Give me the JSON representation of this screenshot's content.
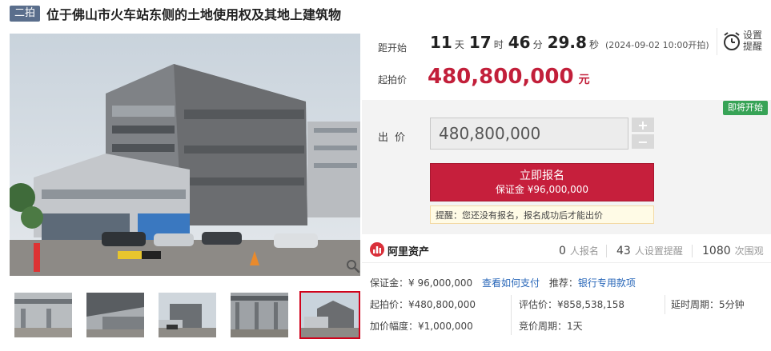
{
  "header": {
    "auction_tag": "二拍",
    "title": "位于佛山市火车站东侧的土地使用权及其地上建筑物"
  },
  "countdown": {
    "label": "距开始",
    "days": "11",
    "days_unit": "天",
    "hours": "17",
    "hours_unit": "时",
    "minutes": "46",
    "minutes_unit": "分",
    "seconds": "29.8",
    "seconds_unit": "秒",
    "start_text": "(2024-09-02 10:00开拍)"
  },
  "remind": {
    "label": "设置提醒",
    "icon": "alarm-clock-icon"
  },
  "start_price": {
    "label": "起拍价",
    "value": "480,800,000",
    "unit": "元"
  },
  "bid": {
    "badge": "即将开始",
    "label": "出价",
    "value": "480,800,000",
    "plus": "+",
    "minus": "−",
    "signup_label": "立即报名",
    "deposit_text": "保证金 ¥96,000,000",
    "notice": "提醒：您还没有报名，报名成功后才能出价"
  },
  "stats": {
    "brand": "阿里资产",
    "signups": "0",
    "signups_unit": "人报名",
    "reminders": "43",
    "reminders_unit": "人设置提醒",
    "views": "1080",
    "views_unit": "次围观"
  },
  "info": {
    "deposit": "保证金：¥ 96,000,000",
    "how_to_pay": "查看如何支付",
    "recommend_label": "推荐：",
    "recommend_link": "银行专用款项",
    "start_price": "起拍价：¥480,800,000",
    "valuation": "评估价：¥858,538,158",
    "delay": "延时周期：5分钟",
    "increment": "加价幅度：¥1,000,000",
    "bid_cycle": "竞价周期：1天"
  },
  "colors": {
    "accent_red": "#c61f3c",
    "price_red": "#c21f3a",
    "badge_green": "#37a356",
    "tag_blue": "#5a6e8c",
    "link_blue": "#2766b8"
  }
}
